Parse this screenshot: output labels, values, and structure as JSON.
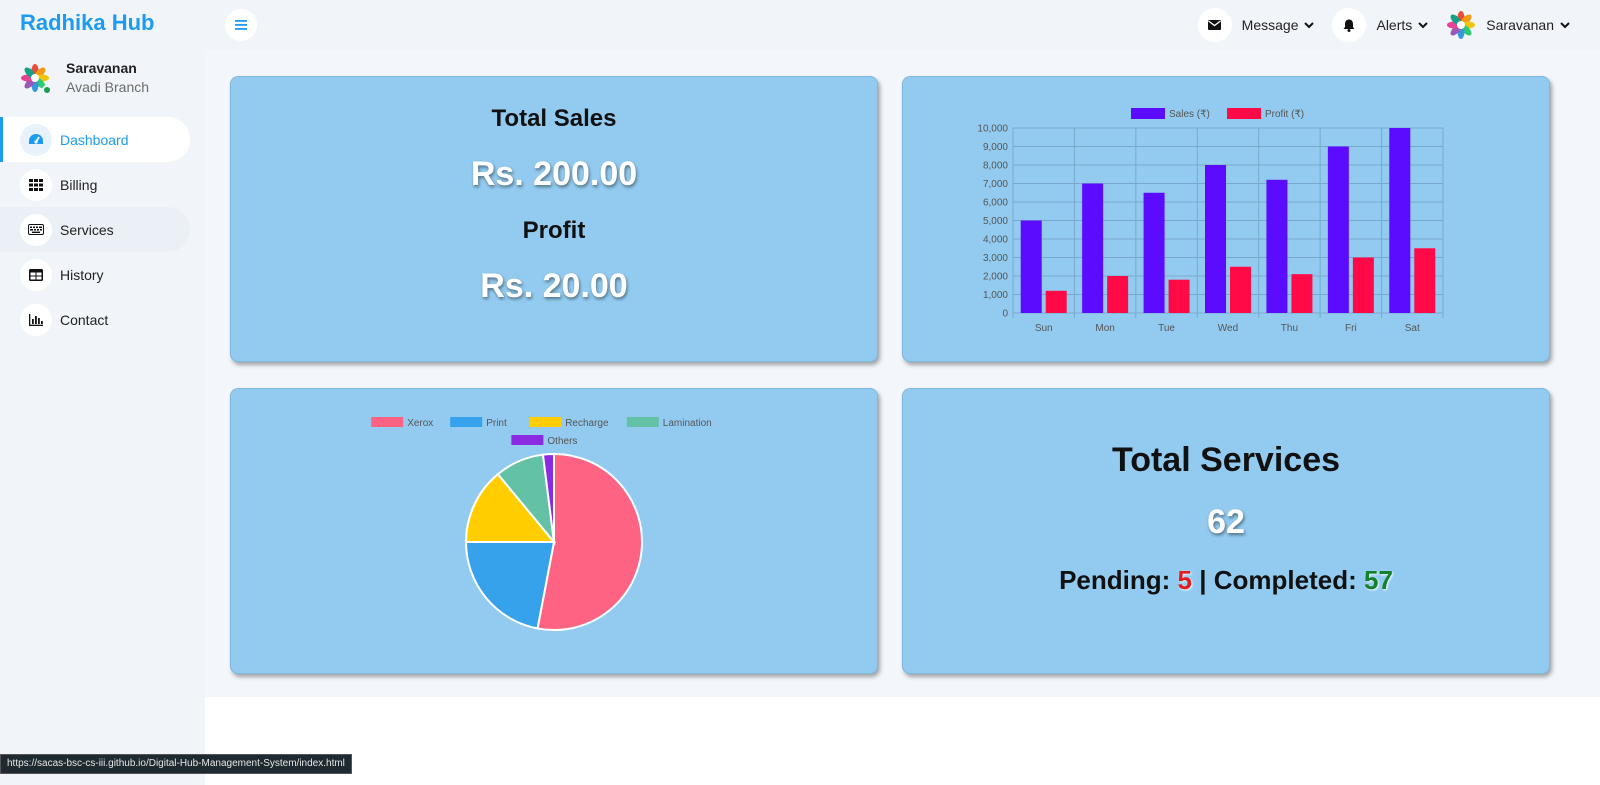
{
  "sidebar": {
    "brand": "Radhika Hub",
    "profile": {
      "name": "Saravanan",
      "branch": "Avadi Branch"
    },
    "items": [
      {
        "label": "Dashboard",
        "icon": "gauge-icon"
      },
      {
        "label": "Billing",
        "icon": "grid-icon"
      },
      {
        "label": "Services",
        "icon": "keyboard-icon"
      },
      {
        "label": "History",
        "icon": "table-icon"
      },
      {
        "label": "Contact",
        "icon": "bar-chart-icon"
      }
    ]
  },
  "topbar": {
    "message_label": "Message",
    "alerts_label": "Alerts",
    "user_label": "Saravanan"
  },
  "sales_card": {
    "sales_title": "Total Sales",
    "sales_value": "Rs. 200.00",
    "profit_title": "Profit",
    "profit_value": "Rs. 20.00"
  },
  "services_card": {
    "title": "Total Services",
    "total": "62",
    "pending_label": "Pending:",
    "pending_value": "5",
    "separator": "|",
    "completed_label": "Completed:",
    "completed_value": "57"
  },
  "status_bar": {
    "url": "https://sacas-bsc-cs-iii.github.io/Digital-Hub-Management-System/index.html"
  },
  "colors": {
    "accent": "#1d9bf0",
    "card": "#93cbf0",
    "sales": "#5b0cff",
    "profit": "#ff0a47"
  },
  "chart_data": [
    {
      "type": "bar",
      "categories": [
        "Sun",
        "Mon",
        "Tue",
        "Wed",
        "Thu",
        "Fri",
        "Sat"
      ],
      "series": [
        {
          "name": "Sales (₹)",
          "color": "#5b0cff",
          "values": [
            5000,
            7000,
            6500,
            8000,
            7200,
            9000,
            10000
          ]
        },
        {
          "name": "Profit (₹)",
          "color": "#ff0a47",
          "values": [
            1200,
            2000,
            1800,
            2500,
            2100,
            3000,
            3500
          ]
        }
      ],
      "ylim": [
        0,
        10000
      ],
      "yticks": [
        "0",
        "1,000",
        "2,000",
        "3,000",
        "4,000",
        "5,000",
        "6,000",
        "7,000",
        "8,000",
        "9,000",
        "10,000"
      ],
      "grid": true,
      "legend": "top"
    },
    {
      "type": "pie",
      "labels": [
        "Xerox",
        "Print",
        "Recharge",
        "Lamination",
        "Others"
      ],
      "values": [
        53,
        22,
        14,
        9,
        2
      ],
      "colors": [
        "#ff6384",
        "#36a2eb",
        "#ffcd00",
        "#63c1a6",
        "#8a2be2"
      ],
      "legend": "top"
    }
  ]
}
